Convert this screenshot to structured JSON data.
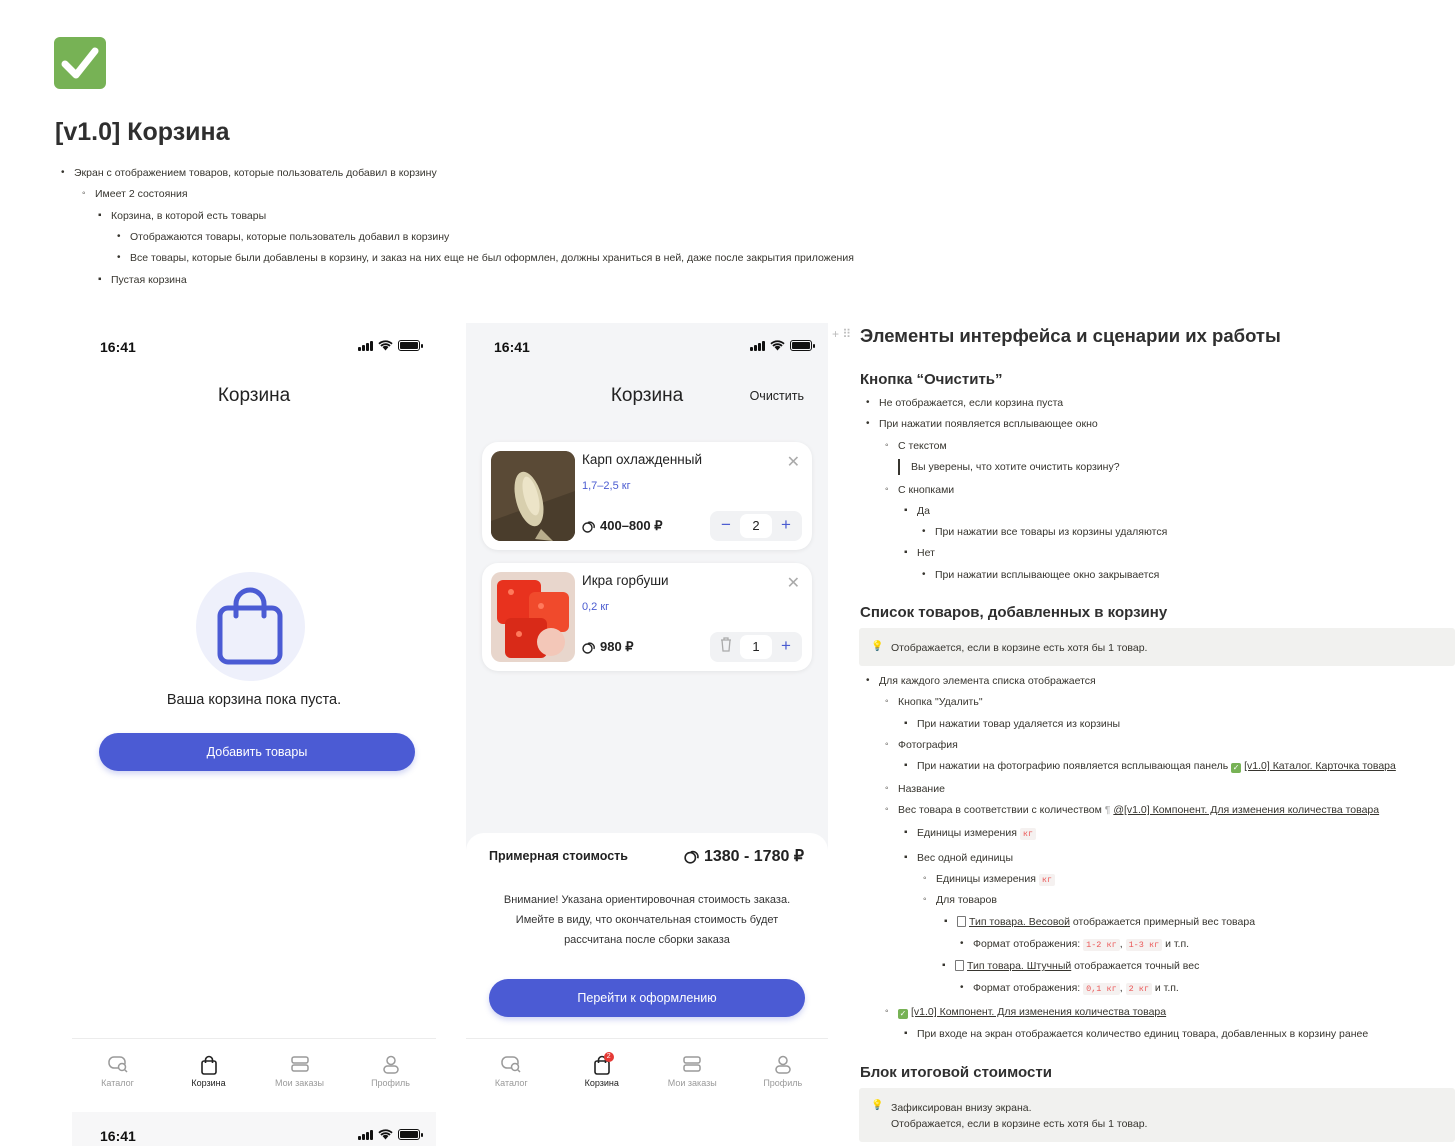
{
  "page": {
    "title": "[v1.0] Корзина",
    "bullets": [
      "Экран с отображением товаров, которые пользователь добавил в корзину",
      "Имеет 2 состояния",
      "Корзина, в которой есть товары",
      "Отображаются товары, которые пользователь добавил в корзину",
      "Все товары, которые были добавлены в корзину, и заказ на них еще не был оформлен, должны храниться в ней, даже после закрытия приложения",
      "Пустая корзина"
    ]
  },
  "status_bar": {
    "time": "16:41"
  },
  "empty_screen": {
    "title": "Корзина",
    "empty_text": "Ваша корзина пока пуста.",
    "add_button": "Добавить товары"
  },
  "filled_screen": {
    "title": "Корзина",
    "clear_label": "Очистить",
    "items": [
      {
        "name": "Карп охлажденный",
        "weight": "1,7–2,5 кг",
        "price": "400–800 ₽",
        "qty": "2"
      },
      {
        "name": "Икра горбуши",
        "weight": "0,2 кг",
        "price": "980 ₽",
        "qty": "1"
      }
    ],
    "total_label": "Примерная стоимость",
    "total_value": "1380 - 1780 ₽",
    "notice_lines": [
      "Внимание! Указана ориентировочная стоимость заказа.",
      "Имейте в виду, что окончательная стоимость будет",
      "рассчитана после сборки заказа"
    ],
    "checkout_button": "Перейти к оформлению",
    "cart_badge": "2"
  },
  "tabs": [
    "Каталог",
    "Корзина",
    "Мои заказы",
    "Профиль"
  ],
  "doc": {
    "h2": "Элементы интерфейса и сценарии их работы",
    "clear_section": {
      "heading": "Кнопка “Очистить”",
      "l1": "Не отображается, если корзина пуста",
      "l2": "При нажатии появляется всплывающее окно",
      "l3": "С текстом",
      "quote": "Вы уверены, что хотите очистить корзину?",
      "l4": "С кнопками",
      "l5": "Да",
      "l6": "При нажатии все товары из корзины удаляются",
      "l7": "Нет",
      "l8": "При нажатии всплывающее окно закрывается"
    },
    "list_section": {
      "heading": "Список товаров, добавленных в корзину",
      "callout": "Отображается, если в корзине есть хотя бы 1 товар.",
      "l1": "Для каждого элемента списка отображается",
      "l2": "Кнопка \"Удалить\"",
      "l3": "При нажатии товар удаляется из корзины",
      "l4": "Фотография",
      "l5": "При нажатии на фотографию появляется всплывающая панель",
      "l5_link": "[v1.0] Каталог. Карточка товара",
      "l6": "Название",
      "l7": "Вес товара в соответствии с количеством",
      "l7_link": "@[v1.0] Компонент. Для изменения количества товара",
      "l8": "Единицы измерения",
      "unit": "кг",
      "l9": "Вес одной единицы",
      "l10": "Единицы измерения",
      "l11": "Для товаров",
      "l12_link": "Тип товара. Весовой",
      "l12": "отображается примерный вес товара",
      "l13": "Формат отображения:",
      "fmt1": "1-2 кг",
      "fmt2": "1-3 кг",
      "etc": "и т.п.",
      "l14_link": "Тип товара. Штучный",
      "l14": "отображается точный вес",
      "fmt3": "0,1 кг",
      "fmt4": "2 кг",
      "l15_link": "[v1.0] Компонент. Для изменения количества товара",
      "l16": "При входе на экран отображается количество единиц товара, добавленных в корзину ранее"
    },
    "total_section": {
      "heading": "Блок итоговой стоимости",
      "callout_l1": "Зафиксирован внизу экрана.",
      "callout_l2": "Отображается, если в корзине есть хотя бы 1 товар."
    }
  }
}
